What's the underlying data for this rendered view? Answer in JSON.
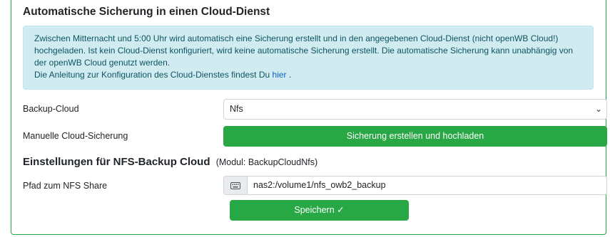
{
  "card": {
    "title": "Automatische Sicherung in einen Cloud-Dienst"
  },
  "alert": {
    "line1": "Zwischen Mitternacht und 5:00 Uhr wird automatisch eine Sicherung erstellt und in den angegebenen Cloud-Dienst (nicht openWB Cloud!) hochgeladen. Ist kein Cloud-Dienst konfiguriert, wird keine automatische Sicherung erstellt. Die automatische Sicherung kann unabhängig von der openWB Cloud genutzt werden.",
    "line2_prefix": "Die Anleitung zur Konfiguration des Cloud-Dienstes findest Du",
    "link_text": "hier",
    "line2_suffix": "."
  },
  "backup_cloud": {
    "label": "Backup-Cloud",
    "selected": "Nfs"
  },
  "manual_backup": {
    "label": "Manuelle Cloud-Sicherung",
    "button": "Sicherung erstellen und hochladen"
  },
  "nfs_settings": {
    "title": "Einstellungen für NFS-Backup Cloud",
    "module": "(Modul: BackupCloudNfs)",
    "path_label": "Pfad zum NFS Share",
    "path_value": "nas2:/volume1/nfs_owb2_backup"
  },
  "save_button": "Speichern ✓",
  "colors": {
    "success": "#28a745",
    "info_bg": "#d1ecf1",
    "info_text": "#0c5460"
  }
}
